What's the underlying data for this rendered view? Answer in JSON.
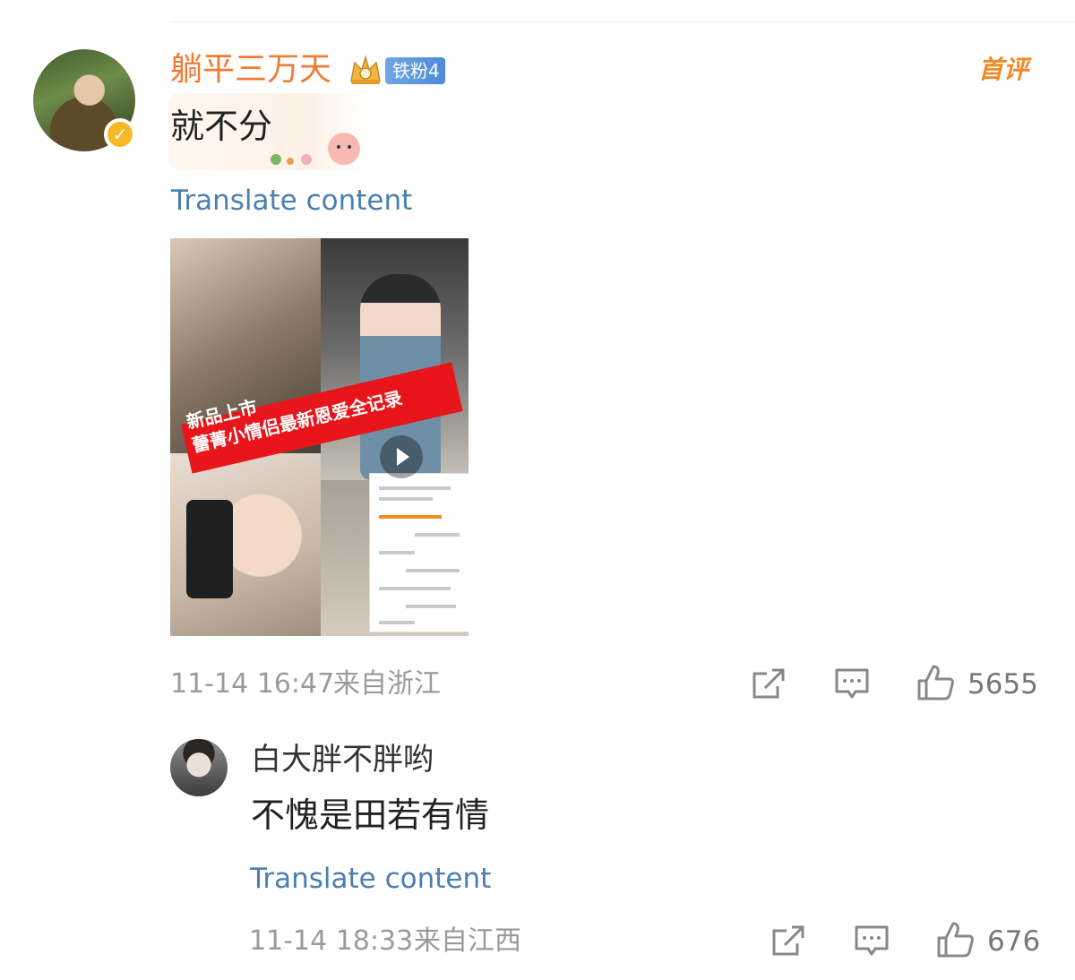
{
  "main_comment": {
    "username": "躺平三万天",
    "fan_badge": "铁粉4",
    "first_comment_tag": "首评",
    "text": "就不分",
    "translate_label": "Translate content",
    "media": {
      "banner_line1": "新品上市",
      "banner_line2": "蕾菁小情侣最新恩爱全记录"
    },
    "timestamp": "11-14 16:47",
    "location": "来自浙江",
    "likes": "5655"
  },
  "reply": {
    "username": "白大胖不胖哟",
    "text": "不愧是田若有情",
    "translate_label": "Translate content",
    "timestamp": "11-14 18:33",
    "location": "来自江西",
    "likes": "676"
  },
  "colors": {
    "username": "#f07b34",
    "translate_link": "#4a7fb0",
    "meta_text": "#9a9a9a",
    "fan_badge": "#5b96df",
    "verified_badge": "#f6b926"
  },
  "icons": [
    "verified-icon",
    "crown-icon",
    "share-icon",
    "comment-icon",
    "like-icon",
    "play-icon"
  ]
}
